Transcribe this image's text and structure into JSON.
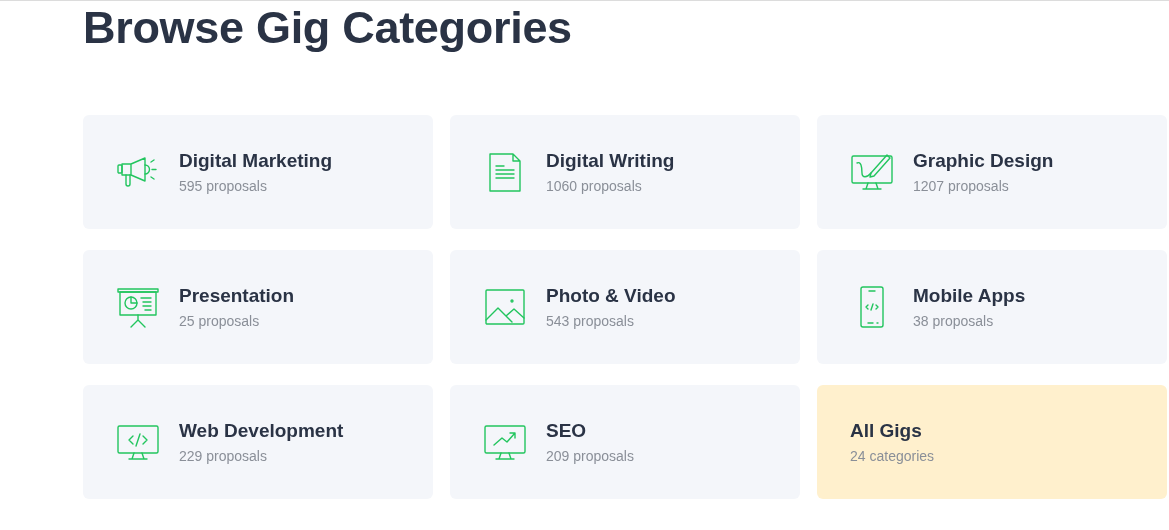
{
  "heading": "Browse Gig Categories",
  "categories": [
    {
      "kind": "category",
      "title": "Digital Marketing",
      "count": "595 proposals"
    },
    {
      "kind": "category",
      "title": "Digital Writing",
      "count": "1060 proposals"
    },
    {
      "kind": "category",
      "title": "Graphic Design",
      "count": "1207 proposals"
    },
    {
      "kind": "category",
      "title": "Presentation",
      "count": "25 proposals"
    },
    {
      "kind": "category",
      "title": "Photo & Video",
      "count": "543 proposals"
    },
    {
      "kind": "category",
      "title": "Mobile Apps",
      "count": "38 proposals"
    },
    {
      "kind": "category",
      "title": "Web Development",
      "count": "229 proposals"
    },
    {
      "kind": "category",
      "title": "SEO",
      "count": "209 proposals"
    },
    {
      "kind": "all",
      "title": "All Gigs",
      "count": "24 categories"
    }
  ]
}
